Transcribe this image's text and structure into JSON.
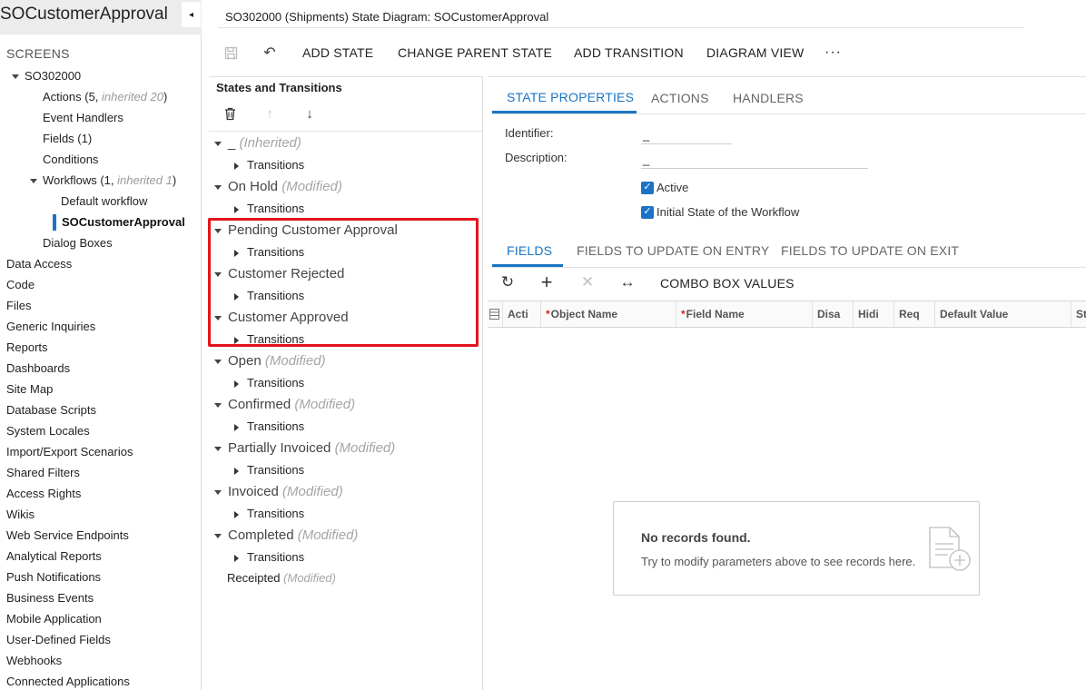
{
  "sidebar": {
    "title": "SOCustomerApproval",
    "collapse_icon": "◂",
    "screens_label": "SCREENS",
    "screen_id": "SO302000",
    "children": [
      {
        "label": "Actions",
        "count": " (5, ",
        "inherited": "inherited 20",
        "close": ")"
      },
      {
        "label": "Event Handlers"
      },
      {
        "label": "Fields (1)"
      },
      {
        "label": "Conditions"
      },
      {
        "label": "Workflows",
        "count": " (1, ",
        "inherited": "inherited 1",
        "close": ")"
      }
    ],
    "workflows": [
      "Default workflow",
      "SOCustomerApproval"
    ],
    "dialog_boxes": "Dialog Boxes",
    "sections": [
      "Data Access",
      "Code",
      "Files",
      "Generic Inquiries",
      "Reports",
      "Dashboards",
      "Site Map",
      "Database Scripts",
      "System Locales",
      "Import/Export Scenarios",
      "Shared Filters",
      "Access Rights",
      "Wikis",
      "Web Service Endpoints",
      "Analytical Reports",
      "Push Notifications",
      "Business Events",
      "Mobile Application",
      "User-Defined Fields",
      "Webhooks",
      "Connected Applications"
    ]
  },
  "header": {
    "title": "SO302000 (Shipments) State Diagram: SOCustomerApproval"
  },
  "toolbar": {
    "save_icon": "💾",
    "undo_icon": "↶",
    "add_state": "ADD STATE",
    "change_parent_state": "CHANGE PARENT STATE",
    "add_transition": "ADD TRANSITION",
    "diagram_view": "DIAGRAM VIEW",
    "more_icon": "···"
  },
  "states_panel": {
    "title": "States and Transitions",
    "delete_icon": "🗑",
    "up_icon": "↑",
    "down_icon": "↓",
    "transitions_label": "Transitions",
    "states": [
      {
        "name": "_",
        "tag": "(Inherited)"
      },
      {
        "name": "On Hold",
        "tag": "(Modified)"
      },
      {
        "name": "Pending Customer Approval",
        "tag": ""
      },
      {
        "name": "Customer Rejected",
        "tag": ""
      },
      {
        "name": "Customer Approved",
        "tag": ""
      },
      {
        "name": "Open",
        "tag": "(Modified)"
      },
      {
        "name": "Confirmed",
        "tag": "(Modified)"
      },
      {
        "name": "Partially Invoiced",
        "tag": "(Modified)"
      },
      {
        "name": "Invoiced",
        "tag": "(Modified)"
      },
      {
        "name": "Completed",
        "tag": "(Modified)"
      }
    ],
    "leaf_state": {
      "name": "Receipted",
      "tag": "(Modified)"
    }
  },
  "details": {
    "tabs": [
      "STATE PROPERTIES",
      "ACTIONS",
      "HANDLERS"
    ],
    "identifier_label": "Identifier:",
    "identifier_value": "_",
    "description_label": "Description:",
    "description_value": "_",
    "active_label": "Active",
    "initial_state_label": "Initial State of the Workflow",
    "checkmark": "✓",
    "field_tabs": [
      "FIELDS",
      "FIELDS TO UPDATE ON ENTRY",
      "FIELDS TO UPDATE ON EXIT"
    ],
    "grid_toolbar": {
      "refresh_icon": "↻",
      "add_icon": "+",
      "delete_icon": "✕",
      "fit_icon": "↔",
      "combo_box_values": "COMBO BOX VALUES"
    },
    "columns": [
      {
        "label": "Acti",
        "required": false
      },
      {
        "label": "Object Name",
        "required": true
      },
      {
        "label": "Field Name",
        "required": true
      },
      {
        "label": "Disa",
        "required": false
      },
      {
        "label": "Hidi",
        "required": false
      },
      {
        "label": "Req",
        "required": false
      },
      {
        "label": "Default Value",
        "required": false
      },
      {
        "label": "St",
        "required": false
      }
    ],
    "empty_title": "No records found.",
    "empty_subtitle": "Try to modify parameters above to see records here."
  },
  "colors": {
    "accent": "#1a74c4",
    "highlight": "#e3141d"
  }
}
